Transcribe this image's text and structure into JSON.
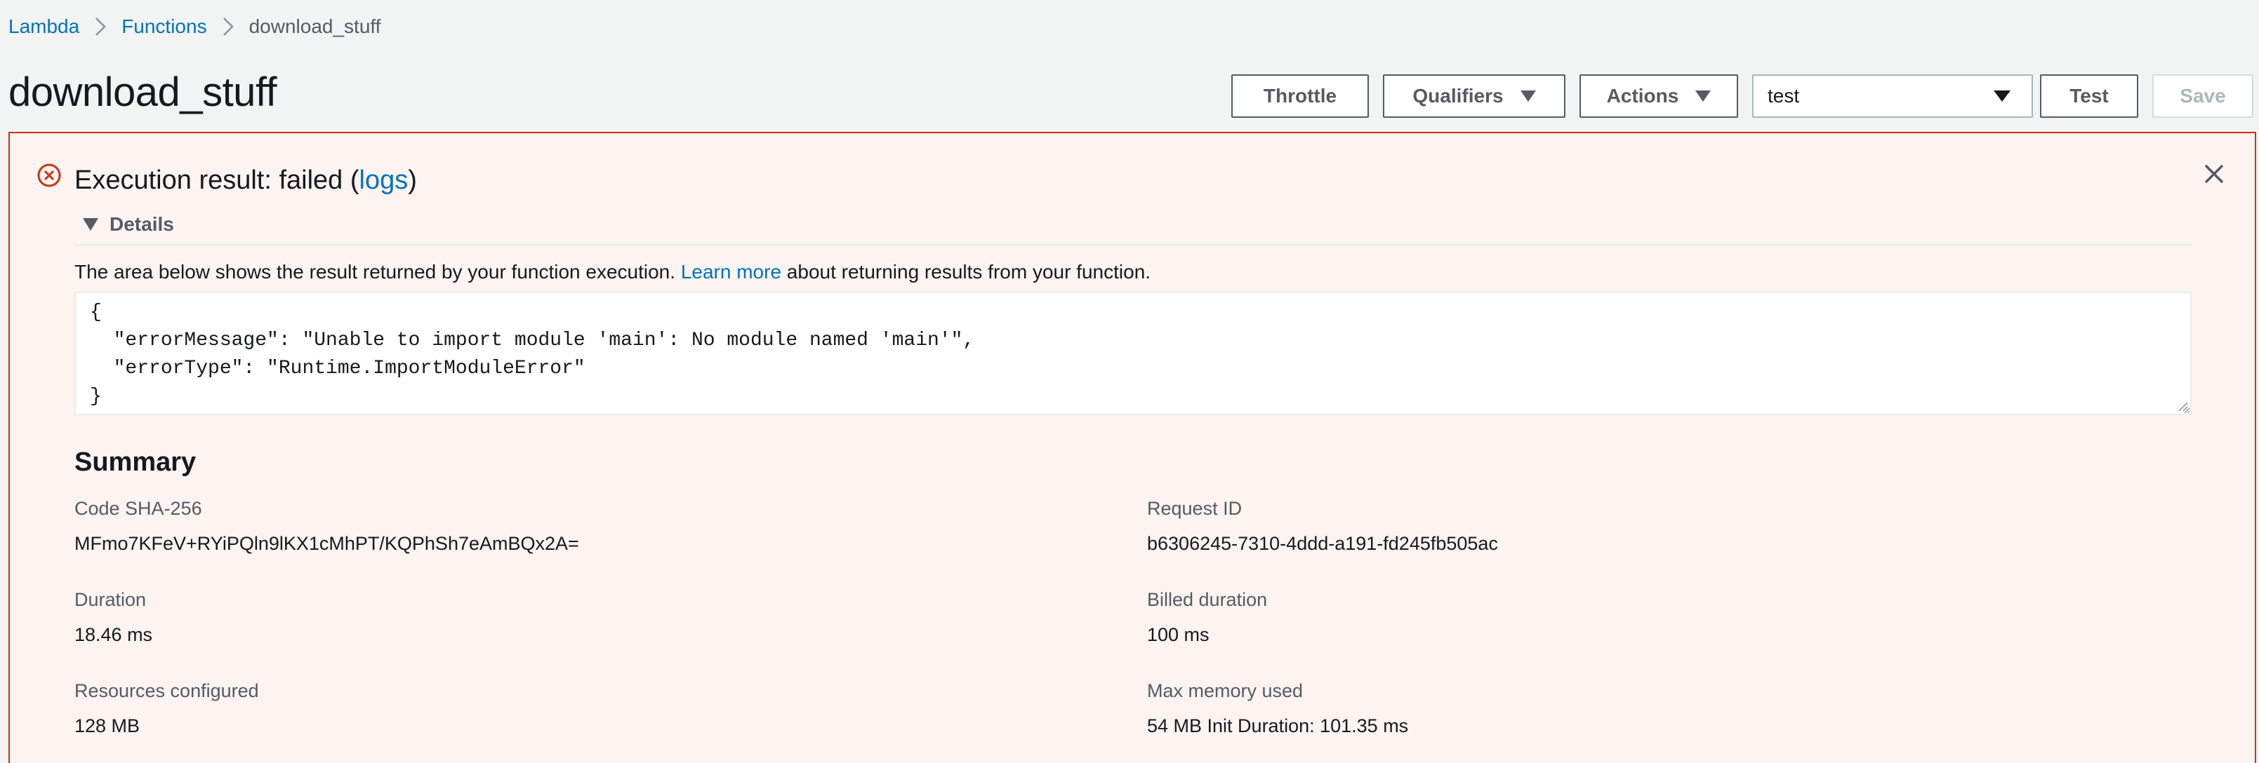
{
  "breadcrumb": {
    "items": [
      "Lambda",
      "Functions"
    ],
    "current": "download_stuff"
  },
  "page": {
    "title": "download_stuff"
  },
  "toolbar": {
    "throttle_label": "Throttle",
    "qualifiers_label": "Qualifiers",
    "actions_label": "Actions",
    "test_event_selected": "test",
    "test_label": "Test",
    "save_label": "Save"
  },
  "result": {
    "title_prefix": "Execution result: failed (",
    "logs_link": "logs",
    "title_suffix": ")",
    "details_label": "Details",
    "description_before": "The area below shows the result returned by your function execution. ",
    "learn_more": "Learn more",
    "description_after": " about returning results from your function.",
    "code_lines": [
      "{",
      "  \"errorMessage\": \"Unable to import module 'main': No module named 'main'\",",
      "  \"errorType\": \"Runtime.ImportModuleError\"",
      "}"
    ]
  },
  "summary": {
    "title": "Summary",
    "fields": [
      {
        "label": "Code SHA-256",
        "value": "MFmo7KFeV+RYiPQln9lKX1cMhPT/KQPhSh7eAmBQx2A="
      },
      {
        "label": "Request ID",
        "value": "b6306245-7310-4ddd-a191-fd245fb505ac"
      },
      {
        "label": "Duration",
        "value": "18.46 ms"
      },
      {
        "label": "Billed duration",
        "value": "100 ms"
      },
      {
        "label": "Resources configured",
        "value": "128 MB"
      },
      {
        "label": "Max memory used",
        "value": "54 MB Init Duration: 101.35 ms"
      }
    ]
  },
  "colors": {
    "link": "#0073bb",
    "error": "#d13212",
    "error_background": "#fdf3f1",
    "page_background": "#f2f3f3"
  },
  "icons": [
    "chevron-right-icon",
    "caret-down-icon",
    "error-circle-icon",
    "close-icon",
    "caret-down-solid-icon",
    "resize-handle-icon"
  ]
}
